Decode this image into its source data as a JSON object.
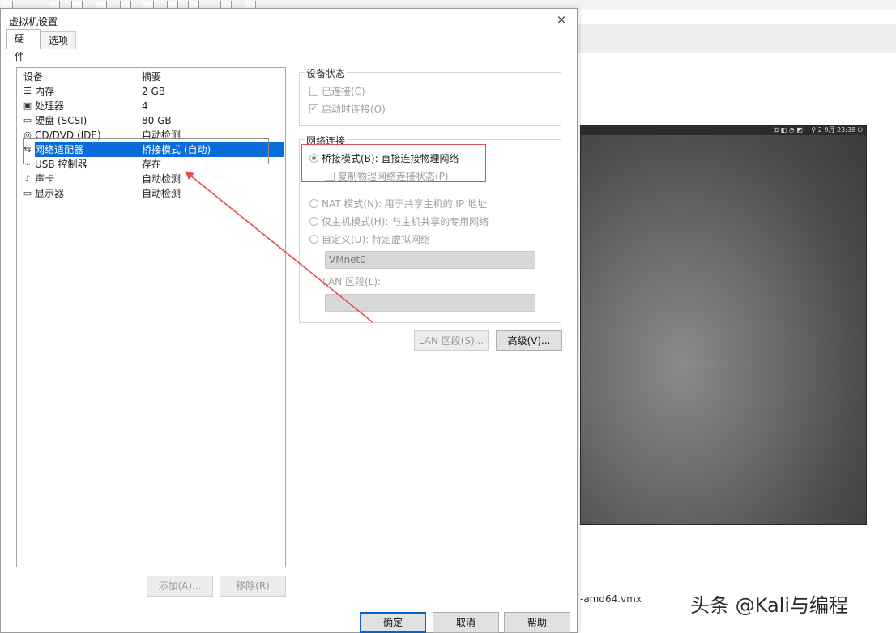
{
  "dialog": {
    "title": "虚拟机设置",
    "close_glyph": "×",
    "tabs": [
      {
        "label": "硬件",
        "active": true
      },
      {
        "label": "选项",
        "active": false
      }
    ]
  },
  "device_list": {
    "col_device": "设备",
    "col_summary": "摘要",
    "rows": [
      {
        "icon": "memory-icon",
        "glyph": "☰",
        "device": "内存",
        "summary": "2 GB",
        "selected": false
      },
      {
        "icon": "processor-icon",
        "glyph": "▣",
        "device": "处理器",
        "summary": "4",
        "selected": false
      },
      {
        "icon": "hard-disk-icon",
        "glyph": "▭",
        "device": "硬盘 (SCSI)",
        "summary": "80 GB",
        "selected": false
      },
      {
        "icon": "cd-dvd-icon",
        "glyph": "◎",
        "device": "CD/DVD (IDE)",
        "summary": "自动检测",
        "selected": false
      },
      {
        "icon": "network-adapter-icon",
        "glyph": "⇆",
        "device": "网络适配器",
        "summary": "桥接模式 (自动)",
        "selected": true
      },
      {
        "icon": "usb-controller-icon",
        "glyph": "⌁",
        "device": "USB 控制器",
        "summary": "存在",
        "selected": false
      },
      {
        "icon": "sound-card-icon",
        "glyph": "♪",
        "device": "声卡",
        "summary": "自动检测",
        "selected": false
      },
      {
        "icon": "display-icon",
        "glyph": "▭",
        "device": "显示器",
        "summary": "自动检测",
        "selected": false
      }
    ],
    "add_button": "添加(A)...",
    "remove_button": "移除(R)"
  },
  "device_status": {
    "legend": "设备状态",
    "connected": {
      "label": "已连接(C)",
      "checked": false
    },
    "connect_on_power_on": {
      "label": "启动时连接(O)",
      "checked": true
    }
  },
  "network_connection": {
    "legend": "网络连接",
    "bridged": {
      "label": "桥接模式(B): 直接连接物理网络",
      "checked": true
    },
    "replicate_state": {
      "label": "复制物理网络连接状态(P)",
      "checked": false
    },
    "nat": {
      "label": "NAT 模式(N): 用于共享主机的 IP 地址",
      "checked": false
    },
    "host_only": {
      "label": "仅主机模式(H): 与主机共享的专用网络",
      "checked": false
    },
    "custom": {
      "label": "自定义(U): 特定虚拟网络",
      "checked": false
    },
    "custom_value": "VMnet0",
    "lan_segment_label": "LAN 区段(L):",
    "lan_segment_value": ""
  },
  "right_buttons": {
    "lan_segment": "LAN 区段(S)...",
    "advanced": "高级(V)..."
  },
  "footer": {
    "ok": "确定",
    "cancel": "取消",
    "help": "帮助"
  },
  "background": {
    "vm_topbar_left": "⊞ ◧ ◔ ◩",
    "vm_topbar_right": "⚲ 2 9月 23:38 ⏻",
    "vmx_file": "-amd64.vmx",
    "watermark": "头条 @Kali与编程"
  },
  "colors": {
    "selection": "#0a6cd8",
    "annotation": "#e05050",
    "primary_border": "#0a64c8"
  }
}
